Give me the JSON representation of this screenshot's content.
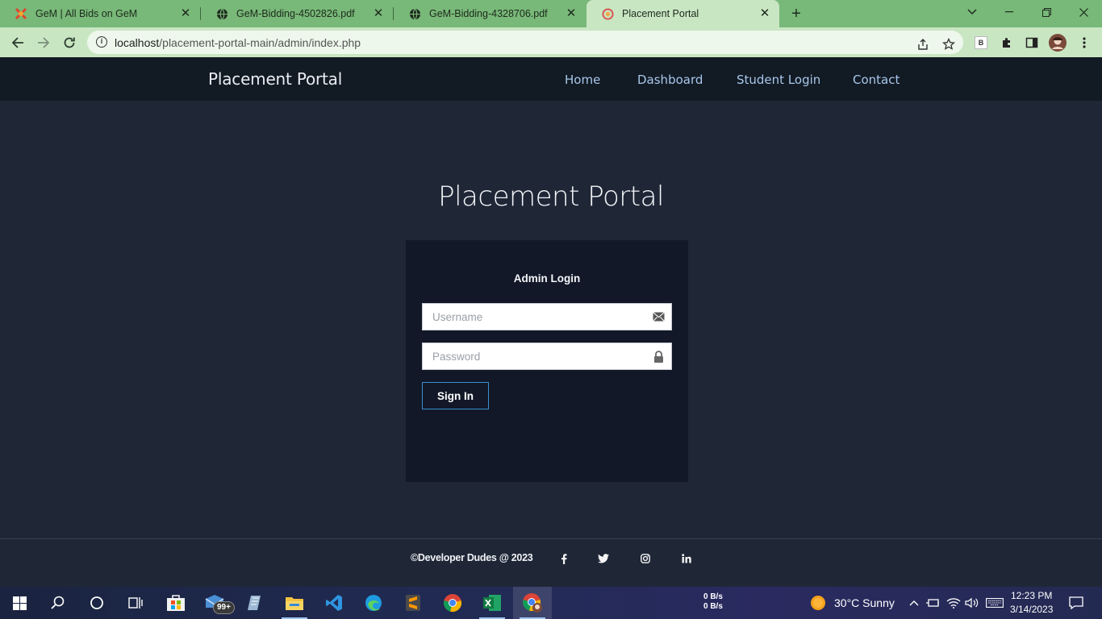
{
  "browser": {
    "tabs": [
      {
        "title": "GeM | All Bids on GeM",
        "favicon": "gem-logo-icon",
        "active": false
      },
      {
        "title": "GeM-Bidding-4502826.pdf",
        "favicon": "globe-icon",
        "active": false
      },
      {
        "title": "GeM-Bidding-4328706.pdf",
        "favicon": "globe-icon",
        "active": false
      },
      {
        "title": "Placement Portal",
        "favicon": "site-icon",
        "active": true
      }
    ],
    "url_host": "localhost",
    "url_path": "/placement-portal-main/admin/index.php",
    "extension_badge": "B"
  },
  "site": {
    "brand": "Placement Portal",
    "nav": [
      "Home",
      "Dashboard",
      "Student Login",
      "Contact"
    ],
    "hero_title": "Placement Portal",
    "login": {
      "heading": "Admin Login",
      "username_placeholder": "Username",
      "username_value": "",
      "password_placeholder": "Password",
      "password_value": "",
      "submit_label": "Sign In"
    },
    "footer": {
      "copyright": "©Developer Dudes @ 2023",
      "social_icons": [
        "facebook-icon",
        "twitter-icon",
        "instagram-icon",
        "linkedin-icon"
      ]
    }
  },
  "taskbar": {
    "mail_badge": "99+",
    "net_up": "0 B/s",
    "net_down": "0 B/s",
    "weather": "30°C  Sunny",
    "time": "12:23 PM",
    "date": "3/14/2023"
  },
  "colors": {
    "tabstrip": "#78b878",
    "toolbar": "#c9e6c3",
    "site_nav": "#121a24",
    "page_bg": "#1f2737",
    "card_bg": "#121827",
    "nav_link": "#a8c8ea",
    "signin_border": "#3b8fd0"
  }
}
